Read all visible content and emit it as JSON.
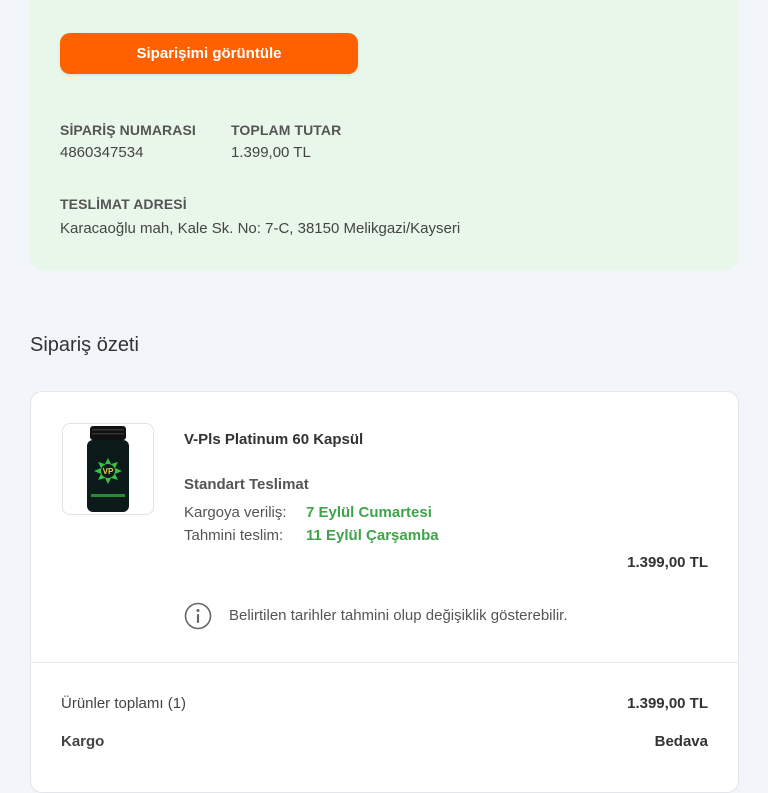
{
  "order_confirmation": {
    "view_order_label": "Siparişimi görüntüle",
    "order_number_label": "SİPARİŞ NUMARASI",
    "order_number": "4860347534",
    "total_label": "TOPLAM TUTAR",
    "total": "1.399,00 TL",
    "address_label": "TESLİMAT ADRESİ",
    "address": "Karacaoğlu mah, Kale Sk. No: 7-C, 38150 Melikgazi/Kayseri"
  },
  "summary": {
    "title": "Sipariş özeti",
    "product": {
      "name": "V-Pls Platinum 60 Kapsül",
      "delivery_type": "Standart Teslimat",
      "shipping_label": "Kargoya veriliş:",
      "shipping_date": "7 Eylül Cumartesi",
      "estimated_label": "Tahmini teslim:",
      "estimated_date": "11 Eylül Çarşamba",
      "price": "1.399,00 TL",
      "note": "Belirtilen tarihler tahmini olup değişiklik gösterebilir."
    },
    "totals": {
      "products_label": "Ürünler toplamı (1)",
      "products_value": "1.399,00 TL",
      "shipping_label": "Kargo",
      "shipping_value": "Bedava"
    }
  },
  "colors": {
    "accent": "#ff6000",
    "success_green": "#3fa54a",
    "panel_green": "#e9f7ea"
  },
  "icons": {
    "info": "info-circle-icon",
    "product_image": "supplement-bottle"
  }
}
